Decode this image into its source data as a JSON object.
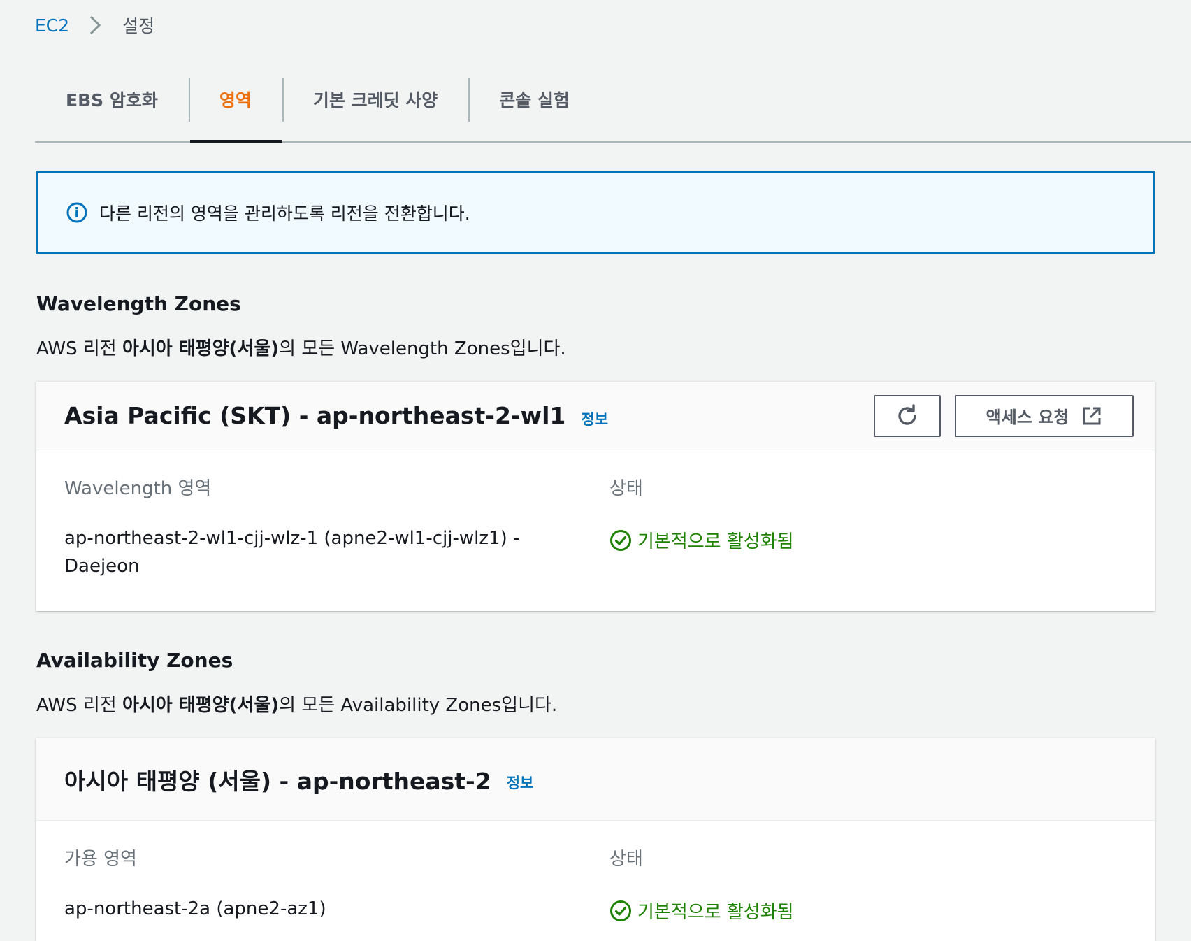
{
  "breadcrumb": {
    "root": "EC2",
    "current": "설정"
  },
  "tabs": [
    {
      "label": "EBS 암호화",
      "active": false
    },
    {
      "label": "영역",
      "active": true
    },
    {
      "label": "기본 크레딧 사양",
      "active": false
    },
    {
      "label": "콘솔 실험",
      "active": false
    }
  ],
  "alert": {
    "text": "다른 리전의 영역을 관리하도록 리전을 전환합니다."
  },
  "wavelength": {
    "title": "Wavelength Zones",
    "desc_prefix": "AWS 리전 ",
    "desc_region": "아시아 태평양(서울)",
    "desc_suffix": "의 모든 Wavelength Zones입니다.",
    "card": {
      "title": "Asia Pacific (SKT) - ap-northeast-2-wl1",
      "info": "정보",
      "access_button": "액세스 요청",
      "col1_label": "Wavelength 영역",
      "col2_label": "상태",
      "zone_line1": "ap-northeast-2-wl1-cjj-wlz-1 (apne2-wl1-cjj-wlz1) -",
      "zone_line2": "Daejeon",
      "status": "기본적으로 활성화됨"
    }
  },
  "availability": {
    "title": "Availability Zones",
    "desc_prefix": "AWS 리전 ",
    "desc_region": "아시아 태평양(서울)",
    "desc_suffix": "의 모든 Availability Zones입니다.",
    "card": {
      "title": "아시아 태평양 (서울) - ap-northeast-2",
      "info": "정보",
      "col1_label": "가용 영역",
      "col2_label": "상태",
      "zone": "ap-northeast-2a (apne2-az1)",
      "status": "기본적으로 활성화됨"
    }
  },
  "colors": {
    "link": "#0073bb",
    "active_tab": "#ec7211",
    "success": "#1d8102",
    "alert_bg": "#f1faff"
  },
  "icons": [
    "chevron-right-icon",
    "info-icon",
    "refresh-icon",
    "external-link-icon",
    "status-success-icon"
  ]
}
